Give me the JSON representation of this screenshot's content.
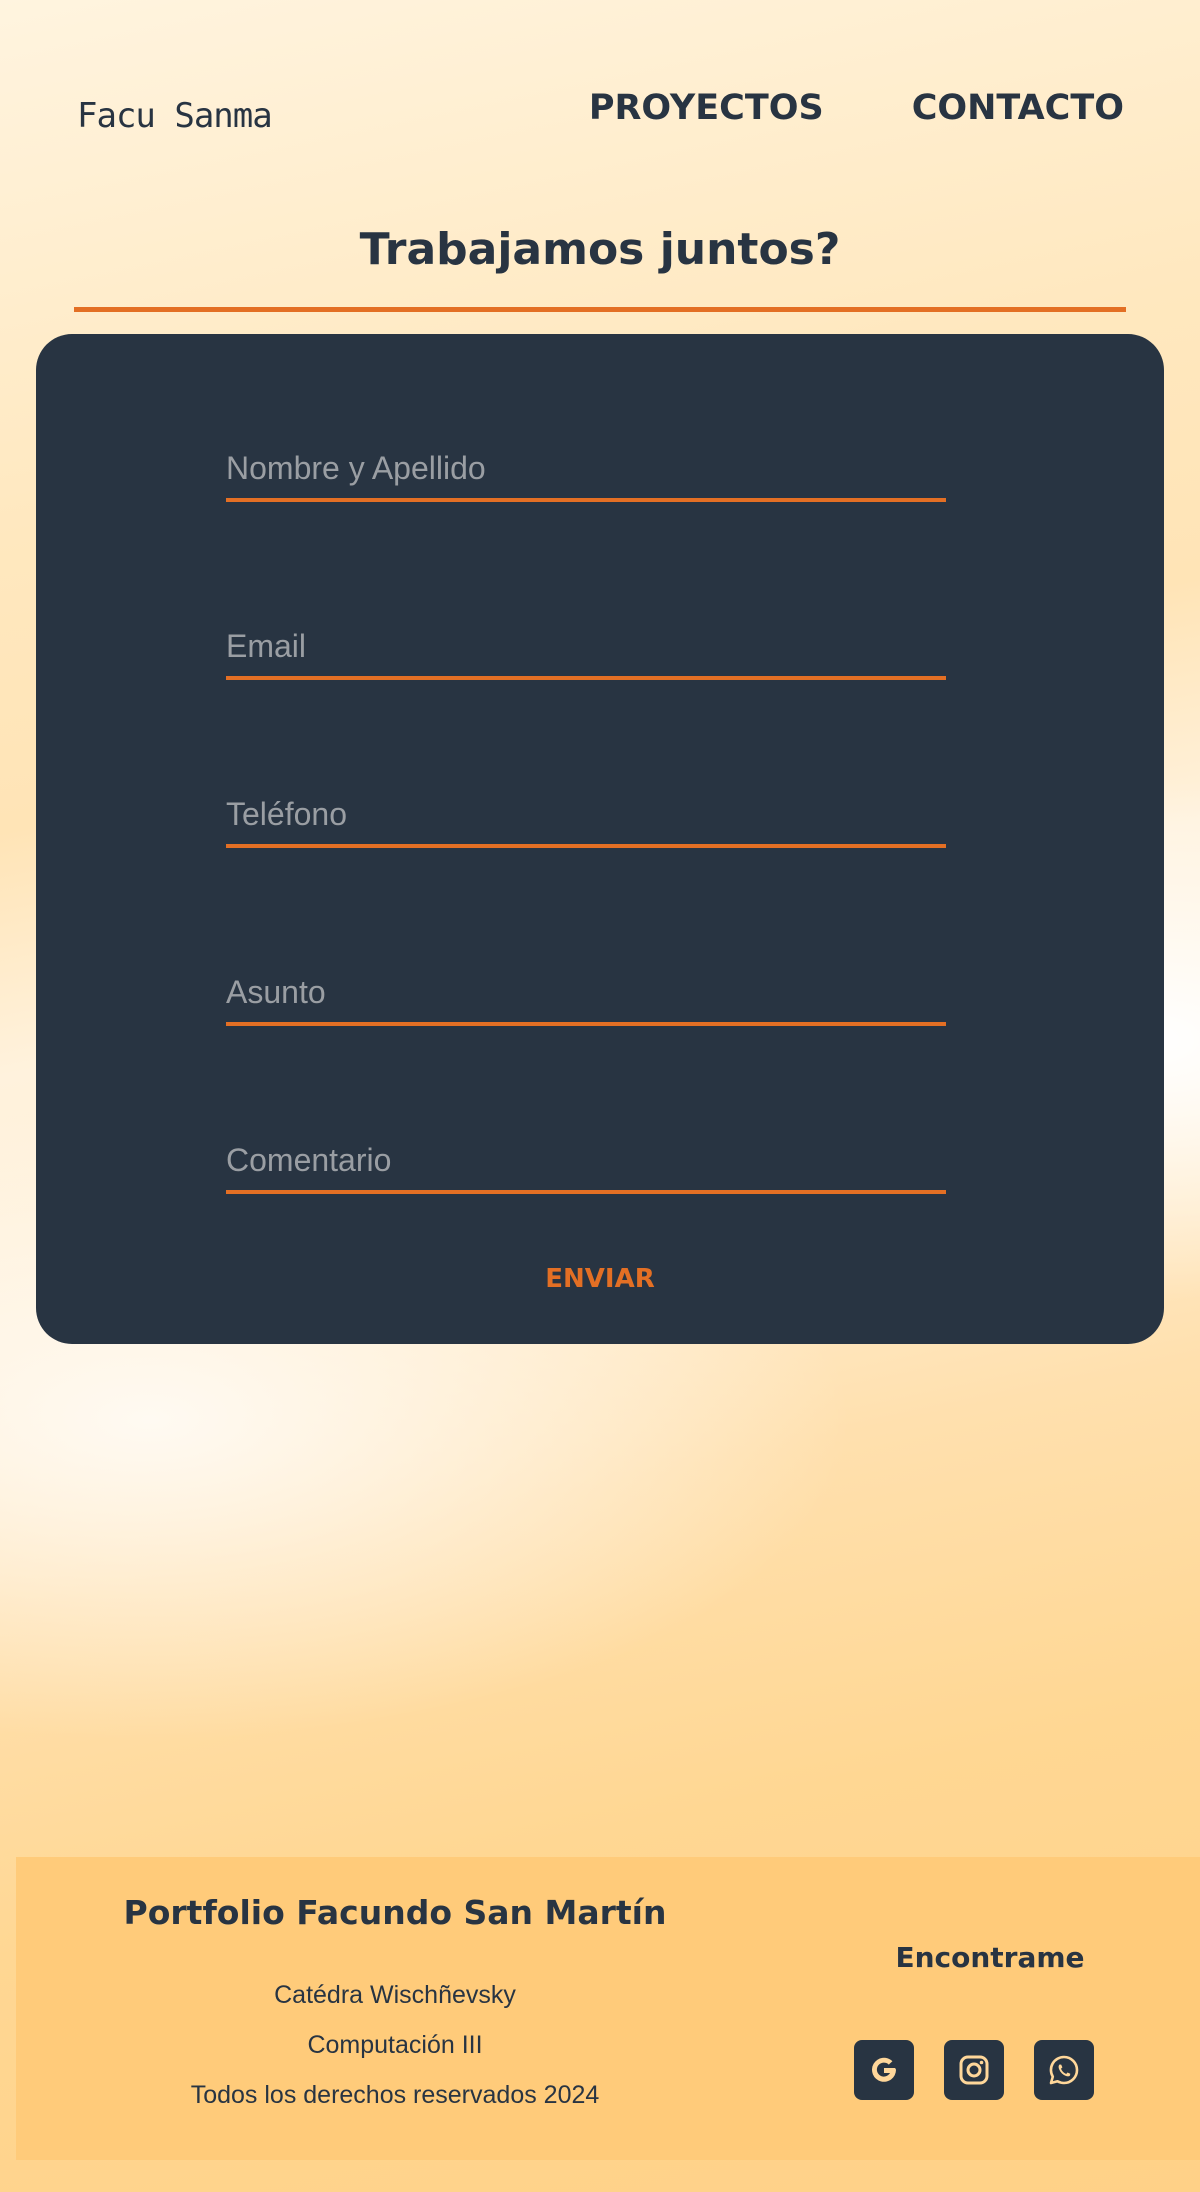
{
  "header": {
    "logo": "Facu Sanma",
    "nav": [
      "PROYECTOS",
      "CONTACTO"
    ]
  },
  "contact": {
    "title": "Trabajamos juntos?",
    "fields": [
      {
        "placeholder": "Nombre y Apellido",
        "value": ""
      },
      {
        "placeholder": "Email",
        "value": ""
      },
      {
        "placeholder": "Teléfono",
        "value": ""
      },
      {
        "placeholder": "Asunto",
        "value": ""
      },
      {
        "placeholder": "Comentario",
        "value": ""
      }
    ],
    "submit_label": "ENVIAR"
  },
  "footer": {
    "title": "Portfolio Facundo San Martín",
    "lines": [
      "Catédra Wischñevsky",
      "Computación III",
      "Todos los derechos reservados 2024"
    ],
    "find_title": "Encontrame",
    "social_icons": [
      "google-icon",
      "instagram-icon",
      "whatsapp-icon"
    ]
  },
  "colors": {
    "dark": "#283442",
    "accent": "#e36f24",
    "footer_bg": "#ffcb7a"
  }
}
